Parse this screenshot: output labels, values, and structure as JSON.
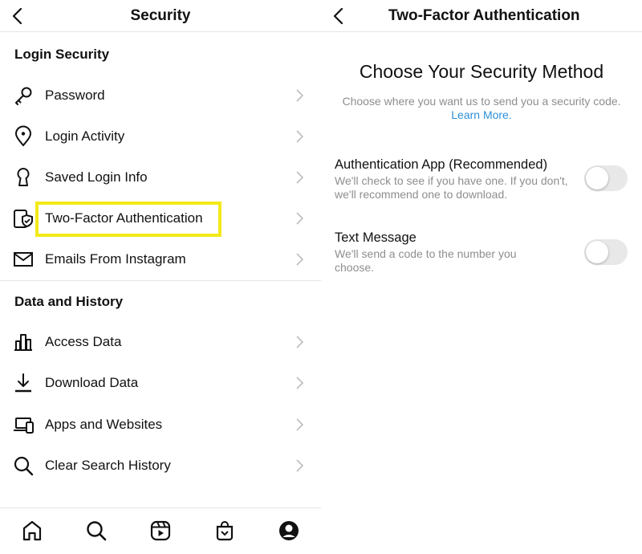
{
  "left_screen": {
    "title": "Security",
    "sections": {
      "login_security": "Login Security",
      "data_history": "Data and History"
    },
    "items": {
      "password": "Password",
      "login_activity": "Login Activity",
      "saved_login": "Saved Login Info",
      "two_factor": "Two-Factor Authentication",
      "emails": "Emails From Instagram",
      "access_data": "Access Data",
      "download_data": "Download Data",
      "apps_websites": "Apps and Websites",
      "clear_search": "Clear Search History"
    },
    "icons": {
      "password": "key-icon",
      "login_activity": "location-pin-icon",
      "saved_login": "keyhole-icon",
      "two_factor": "phone-shield-icon",
      "emails": "envelope-icon",
      "access_data": "bar-chart-icon",
      "download_data": "download-icon",
      "apps_websites": "devices-icon",
      "clear_search": "search-icon"
    },
    "highlight_color": "#f2ea18",
    "bottom_nav": [
      "home-icon",
      "search-icon",
      "reels-icon",
      "shop-icon",
      "profile-icon"
    ]
  },
  "right_screen": {
    "title": "Two-Factor Authentication",
    "heading": "Choose Your Security Method",
    "subtext": "Choose where you want us to send you a security code.",
    "learn_more": "Learn More.",
    "options": {
      "auth_app": {
        "title": "Authentication App (Recommended)",
        "desc": "We'll check to see if you have one. If you don't, we'll recommend one to download.",
        "enabled": false
      },
      "text_message": {
        "title": "Text Message",
        "desc": "We'll send a code to the number you choose.",
        "enabled": false
      }
    },
    "link_color": "#2f8fd8"
  }
}
